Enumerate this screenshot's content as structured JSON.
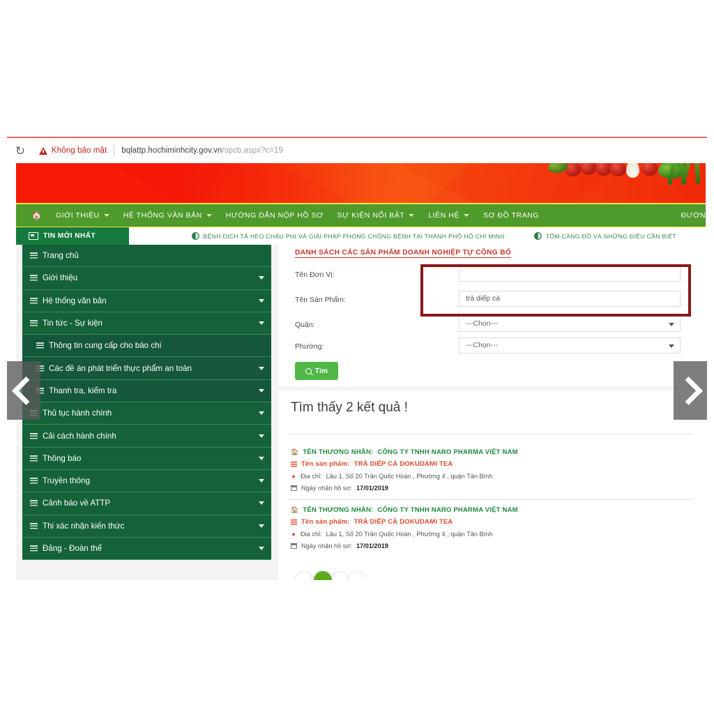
{
  "browser": {
    "reload_icon": "reload-icon",
    "security_warning": "Không bảo mật",
    "url_host": "bqlattp.hochiminhcity.gov.vn",
    "url_path": "/spcb.aspx?c=19"
  },
  "nav": {
    "home_icon": "home-icon",
    "items": [
      {
        "label": "GIỚI THIỆU",
        "caret": true
      },
      {
        "label": "HỆ THỐNG VĂN BẢN",
        "caret": true
      },
      {
        "label": "HƯỚNG DẪN NỘP HỒ SƠ",
        "caret": false
      },
      {
        "label": "SỰ KIỆN NỔI BẬT",
        "caret": true
      },
      {
        "label": "LIÊN HỆ",
        "caret": true
      },
      {
        "label": "SƠ ĐỒ TRANG",
        "caret": false
      }
    ],
    "right_cut_label": "ĐƯỜN"
  },
  "ticker": {
    "badge": "TIN MỚI NHẤT",
    "items": [
      "BỆNH DỊCH TẢ HEO CHÂU PHI VÀ GIẢI PHÁP PHÒNG CHỐNG BỆNH TẠI THÀNH PHỐ HỒ CHÍ MINH",
      "TÔM CÀNG ĐỎ VÀ NHỮNG ĐIỀU CẦN BIẾT"
    ]
  },
  "sidebar": {
    "items": [
      {
        "label": "Trang chủ",
        "caret": false,
        "sub": false
      },
      {
        "label": "Giới thiệu",
        "caret": true,
        "sub": false
      },
      {
        "label": "Hệ thống văn bản",
        "caret": true,
        "sub": false
      },
      {
        "label": "Tin tức - Sự kiện",
        "caret": true,
        "sub": false
      },
      {
        "label": "Thông tin cung cấp cho báo chí",
        "caret": false,
        "sub": true
      },
      {
        "label": "Các đề án phát triển thực phẩm an toàn",
        "caret": true,
        "sub": true
      },
      {
        "label": "Thanh tra, kiểm tra",
        "caret": true,
        "sub": true
      },
      {
        "label": "Thủ tục hành chính",
        "caret": true,
        "sub": false
      },
      {
        "label": "Cải cách hành chính",
        "caret": true,
        "sub": false
      },
      {
        "label": "Thông báo",
        "caret": true,
        "sub": false
      },
      {
        "label": "Truyền thông",
        "caret": true,
        "sub": false
      },
      {
        "label": "Cảnh báo về ATTP",
        "caret": true,
        "sub": false
      },
      {
        "label": "Thi xác nhận kiến thức",
        "caret": true,
        "sub": false
      },
      {
        "label": "Đảng - Đoàn thể",
        "caret": true,
        "sub": false
      }
    ]
  },
  "search": {
    "title": "DANH SÁCH CÁC SẢN PHẨM DOANH NGHIỆP TỰ CÔNG BỐ",
    "fields": [
      {
        "label": "Tên Đơn Vị:",
        "value": "",
        "type": "text"
      },
      {
        "label": "Tên Sản Phẩm:",
        "value": "trà diếp cá",
        "type": "text"
      },
      {
        "label": "Quận:",
        "value": "---Chọn---",
        "type": "select"
      },
      {
        "label": "Phường:",
        "value": "---Chọn---",
        "type": "select"
      }
    ],
    "submit_label": "Tìm",
    "submit_icon": "search-icon"
  },
  "results": {
    "heading": "Tìm thấy 2 kết quả !",
    "labels": {
      "merchant": "TÊN THƯƠNG NHÂN:",
      "product": "Tên sản phẩm:",
      "address": "Địa chỉ:",
      "date": "Ngày nhận hồ sơ:"
    },
    "items": [
      {
        "merchant": "CÔNG TY TNHH NARO PHARMA VIỆT NAM",
        "product": "TRÀ DIẾP CÁ DOKUDAMI TEA",
        "address": "Lầu 1, Số 20 Trần Quốc Hoàn , Phường 4 , quận Tân Bình",
        "date": "17/01/2019"
      },
      {
        "merchant": "CÔNG TY TNHH NARO PHARMA VIỆT NAM",
        "product": "TRÀ DIẾP CÁ DOKUDAMI TEA",
        "address": "Lầu 1, Số 20 Trần Quốc Hoàn , Phường 4 , quận Tân Bình",
        "date": "17/01/2019"
      }
    ]
  },
  "overlays": {
    "left_arrow_icon": "chevron-left-icon",
    "right_arrow_icon": "chevron-right-icon",
    "scroll_top_icon": "scroll-to-top-icon"
  },
  "colors": {
    "nav_green": "#4e9a2b",
    "sidebar_green": "#15623a",
    "badge_green": "#167a3e",
    "button_green": "#51b848",
    "annotation_red": "#8c1818",
    "title_red": "#c0392b",
    "merchant_green": "#1e8a3c",
    "product_orange": "#e0492c",
    "warning_red": "#c5221f"
  }
}
